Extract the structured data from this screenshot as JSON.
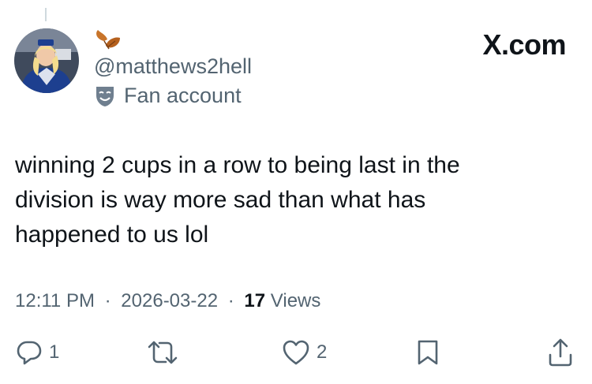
{
  "brand": "X.com",
  "author": {
    "handle": "@matthews2hell",
    "label": "Fan account",
    "avatar_icon": "profile-avatar",
    "decoration_icon": "autumn-leaves-icon",
    "label_icon": "theater-mask-icon"
  },
  "tweet": {
    "text": "winning 2 cups in a row to being last in the\ndivision is way more sad than what has\nhappened to us lol"
  },
  "meta": {
    "time": "12:11 PM",
    "date": "2026-03-22",
    "views_count": "17",
    "views_label": "Views",
    "separator": "·"
  },
  "actions": {
    "replies": "1",
    "likes": "2",
    "reply_icon": "reply-icon",
    "retweet_icon": "retweet-icon",
    "like_icon": "heart-icon",
    "bookmark_icon": "bookmark-icon",
    "share_icon": "share-icon"
  },
  "colors": {
    "text_primary": "#0f1419",
    "text_secondary": "#536471",
    "leaf": "#c8742a"
  }
}
